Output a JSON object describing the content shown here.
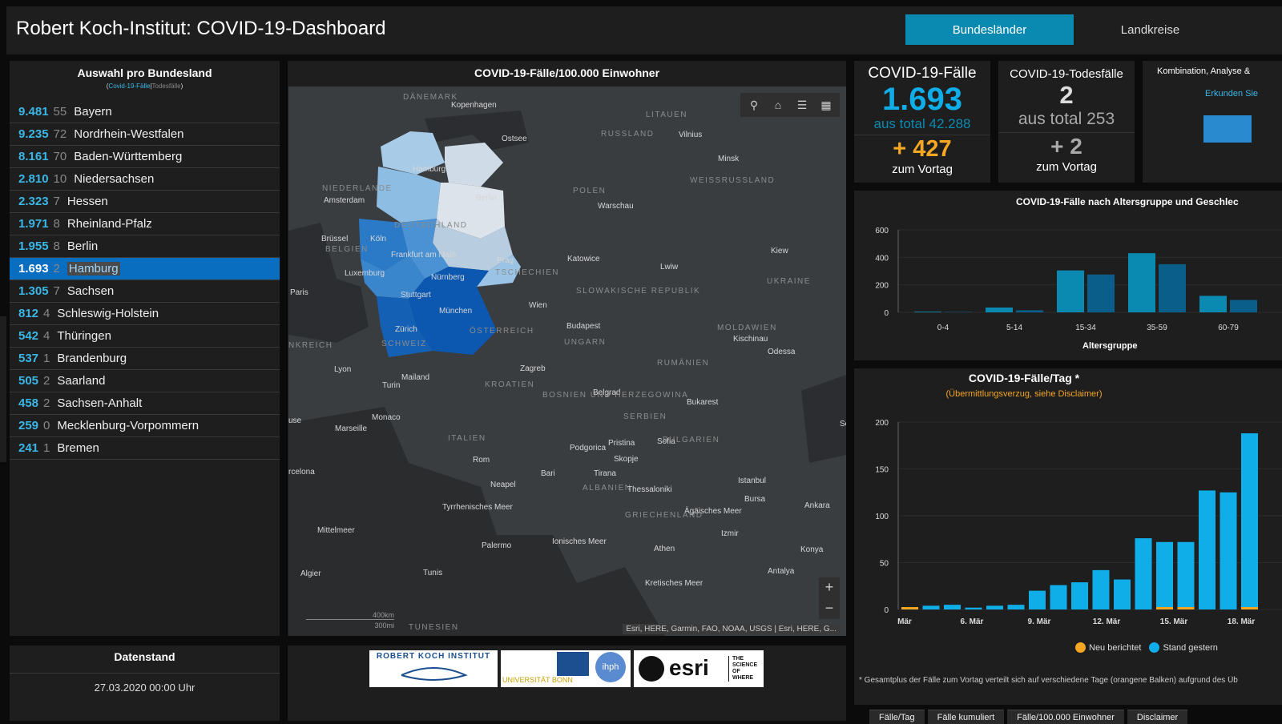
{
  "header": {
    "title": "Robert Koch-Institut: COVID-19-Dashboard",
    "btn_bundeslaender": "Bundesländer",
    "btn_landkreise": "Landkreise"
  },
  "list": {
    "title": "Auswahl pro Bundesland",
    "sub_faelle": "Covid-19-Fälle",
    "sub_sep": "|",
    "sub_tode": "Todesfälle",
    "rows": [
      {
        "cases": "9.481",
        "deaths": "55",
        "name": "Bayern"
      },
      {
        "cases": "9.235",
        "deaths": "72",
        "name": "Nordrhein-Westfalen"
      },
      {
        "cases": "8.161",
        "deaths": "70",
        "name": "Baden-Württemberg"
      },
      {
        "cases": "2.810",
        "deaths": "10",
        "name": "Niedersachsen"
      },
      {
        "cases": "2.323",
        "deaths": "7",
        "name": "Hessen"
      },
      {
        "cases": "1.971",
        "deaths": "8",
        "name": "Rheinland-Pfalz"
      },
      {
        "cases": "1.955",
        "deaths": "8",
        "name": "Berlin"
      },
      {
        "cases": "1.693",
        "deaths": "2",
        "name": "Hamburg"
      },
      {
        "cases": "1.305",
        "deaths": "7",
        "name": "Sachsen"
      },
      {
        "cases": "812",
        "deaths": "4",
        "name": "Schleswig-Holstein"
      },
      {
        "cases": "542",
        "deaths": "4",
        "name": "Thüringen"
      },
      {
        "cases": "537",
        "deaths": "1",
        "name": "Brandenburg"
      },
      {
        "cases": "505",
        "deaths": "2",
        "name": "Saarland"
      },
      {
        "cases": "458",
        "deaths": "2",
        "name": "Sachsen-Anhalt"
      },
      {
        "cases": "259",
        "deaths": "0",
        "name": "Mecklenburg-Vorpommern"
      },
      {
        "cases": "241",
        "deaths": "1",
        "name": "Bremen"
      }
    ],
    "selected": "Hamburg"
  },
  "datenstand": {
    "title": "Datenstand",
    "value": "27.03.2020 00:00 Uhr"
  },
  "map": {
    "title": "COVID-19-Fälle/100.000 Einwohner",
    "attribution": "Esri, HERE, Garmin, FAO, NOAA, USGS | Esri, HERE, G...",
    "scale_km": "400km",
    "scale_mi": "300mi",
    "tools": [
      "search-icon",
      "home-icon",
      "list-icon",
      "grid-icon"
    ],
    "labels": [
      {
        "t": "DÄNEMARK",
        "cap": true
      },
      {
        "t": "Kopenhagen"
      },
      {
        "t": "Ostsee"
      },
      {
        "t": "LITAUEN",
        "cap": true
      },
      {
        "t": "RUSSLAND",
        "cap": true
      },
      {
        "t": "Vilnius"
      },
      {
        "t": "Minsk"
      },
      {
        "t": "WEISSRUSSLAND",
        "cap": true
      },
      {
        "t": "NIEDERLANDE",
        "cap": true
      },
      {
        "t": "Amsterdam"
      },
      {
        "t": "Hamburg"
      },
      {
        "t": "Berlin"
      },
      {
        "t": "POLEN",
        "cap": true
      },
      {
        "t": "Warschau"
      },
      {
        "t": "DEUTSCHLAND",
        "cap": true
      },
      {
        "t": "Brüssel"
      },
      {
        "t": "BELGIEN",
        "cap": true
      },
      {
        "t": "Köln"
      },
      {
        "t": "Frankfurt am Main"
      },
      {
        "t": "Luxemburg"
      },
      {
        "t": "Prag"
      },
      {
        "t": "TSCHECHIEN",
        "cap": true
      },
      {
        "t": "Katowice"
      },
      {
        "t": "Kiew"
      },
      {
        "t": "Lwiw"
      },
      {
        "t": "UKRAINE",
        "cap": true
      },
      {
        "t": "Nürnberg"
      },
      {
        "t": "Paris"
      },
      {
        "t": "Stuttgart"
      },
      {
        "t": "SLOWAKISCHE REPUBLIK",
        "cap": true
      },
      {
        "t": "München"
      },
      {
        "t": "Wien"
      },
      {
        "t": "Zürich"
      },
      {
        "t": "Budapest"
      },
      {
        "t": "SCHWEIZ",
        "cap": true
      },
      {
        "t": "ÖSTERREICH",
        "cap": true
      },
      {
        "t": "NKREICH",
        "cap": true
      },
      {
        "t": "UNGARN",
        "cap": true
      },
      {
        "t": "MOLDAWIEN",
        "cap": true
      },
      {
        "t": "Kischinau"
      },
      {
        "t": "Odessa"
      },
      {
        "t": "Lyon"
      },
      {
        "t": "Mailand"
      },
      {
        "t": "Zagreb"
      },
      {
        "t": "Turin"
      },
      {
        "t": "RUMÄNIEN",
        "cap": true
      },
      {
        "t": "KROATIEN",
        "cap": true
      },
      {
        "t": "Belgrad"
      },
      {
        "t": "BOSNIEN UND HERZEGOWINA",
        "cap": true
      },
      {
        "t": "Bukarest"
      },
      {
        "t": "Monaco"
      },
      {
        "t": "SERBIEN",
        "cap": true
      },
      {
        "t": "Marseille"
      },
      {
        "t": "use"
      },
      {
        "t": "ITALIEN",
        "cap": true
      },
      {
        "t": "Pristina"
      },
      {
        "t": "Sofia"
      },
      {
        "t": "BULGARIEN",
        "cap": true
      },
      {
        "t": "Podgorica"
      },
      {
        "t": "Skopje"
      },
      {
        "t": "Rom"
      },
      {
        "t": "rcelona"
      },
      {
        "t": "Bari"
      },
      {
        "t": "Tirana"
      },
      {
        "t": "Istanbul"
      },
      {
        "t": "Neapel"
      },
      {
        "t": "ALBANIEN",
        "cap": true
      },
      {
        "t": "Thessaloniki"
      },
      {
        "t": "Bursa"
      },
      {
        "t": "Ankara"
      },
      {
        "t": "Tyrrhenisches Meer"
      },
      {
        "t": "Ägäisches Meer"
      },
      {
        "t": "GRIECHENLAND",
        "cap": true
      },
      {
        "t": "Mittelmeer"
      },
      {
        "t": "Izmir"
      },
      {
        "t": "Palermo"
      },
      {
        "t": "Ionisches Meer"
      },
      {
        "t": "Athen"
      },
      {
        "t": "Konya"
      },
      {
        "t": "Algier"
      },
      {
        "t": "Tunis"
      },
      {
        "t": "Antalya"
      },
      {
        "t": "Kretisches Meer"
      },
      {
        "t": "TUNESIEN",
        "cap": true
      },
      {
        "t": "Schwa Mee"
      }
    ]
  },
  "stats": {
    "cases": {
      "title": "COVID-19-Fälle",
      "value": "1.693",
      "total": "aus total 42.288",
      "delta": "+ 427",
      "delta_lbl": "zum Vortag"
    },
    "deaths": {
      "title": "COVID-19-Todesfälle",
      "value": "2",
      "total": "aus total 253",
      "delta": "+ 2",
      "delta_lbl": "zum Vortag"
    },
    "combo": {
      "title": "Kombination, Analyse &",
      "link": "Erkunden Sie"
    }
  },
  "colors": {
    "accent": "#0a8ab0",
    "cyan": "#10aee8",
    "dark_bar": "#0a5f8a",
    "orange": "#f5a623",
    "panel": "#1e1e1e"
  },
  "age_chart": {
    "title": "COVID-19-Fälle nach Altersgruppe und Geschlec",
    "xlabel": "Altersgruppe",
    "chart_data": {
      "type": "bar",
      "categories": [
        "0-4",
        "5-14",
        "15-34",
        "35-59",
        "60-79"
      ],
      "series": [
        {
          "values": [
            5,
            35,
            305,
            430,
            120
          ]
        },
        {
          "values": [
            3,
            15,
            275,
            350,
            90
          ]
        }
      ],
      "yticks": [
        0,
        200,
        400,
        600
      ],
      "ylim": [
        0,
        600
      ]
    }
  },
  "daily_chart": {
    "title": "COVID-19-Fälle/Tag *",
    "subtitle": "(Übermittlungsverzug, siehe Disclaimer)",
    "legend_new": "Neu berichtet",
    "legend_prev": "Stand gestern",
    "footnote": "* Gesamtplus der Fälle zum Vortag verteilt sich auf verschiedene Tage (orangene Balken) aufgrund des Üb",
    "chart_data": {
      "type": "bar",
      "ticks": [
        "Mär",
        "6. Mär",
        "9. Mär",
        "12. Mär",
        "15. Mär",
        "18. Mär"
      ],
      "stand_gestern": [
        1,
        4,
        5,
        2,
        4,
        5,
        20,
        26,
        29,
        42,
        32,
        76,
        72,
        72,
        127,
        125,
        188
      ],
      "neu_berichtet": [
        1,
        0,
        0,
        0,
        0,
        0,
        0,
        0,
        0,
        0,
        0,
        0,
        2,
        2,
        0,
        0,
        3
      ],
      "yticks": [
        0,
        50,
        100,
        150,
        200
      ],
      "ylim": [
        0,
        200
      ]
    }
  },
  "logos": {
    "rki": "ROBERT KOCH INSTITUT",
    "uni": "UNIVERSITÄT BONN",
    "esri": "esri",
    "esri_tag": "THE SCIENCE OF WHERE",
    "ihph": "ihph"
  },
  "tabs": [
    "Fälle/Tag",
    "Fälle kumuliert",
    "Fälle/100.000 Einwohner",
    "Disclaimer"
  ]
}
